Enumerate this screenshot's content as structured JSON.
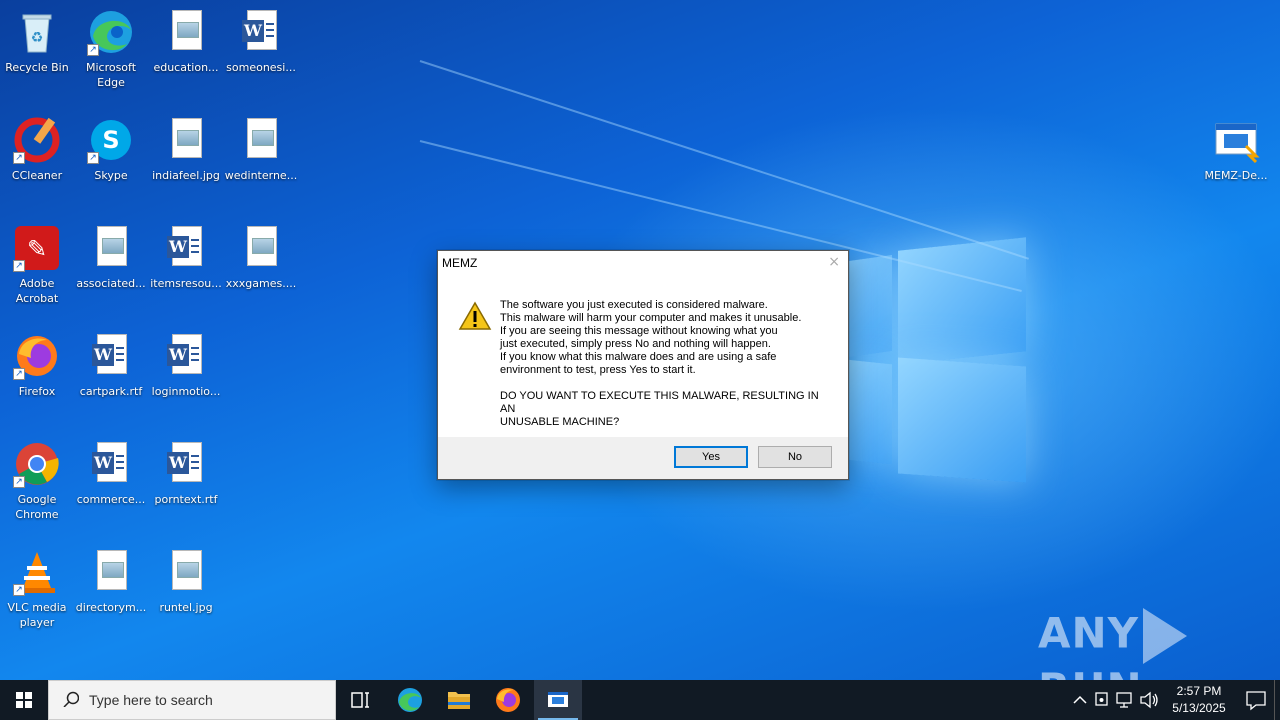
{
  "desktop": {
    "icons": [
      {
        "label": "Recycle Bin"
      },
      {
        "label": "Microsoft Edge"
      },
      {
        "label": "education..."
      },
      {
        "label": "someonesi..."
      },
      {
        "label": "CCleaner"
      },
      {
        "label": "Skype"
      },
      {
        "label": "indiafeel.jpg"
      },
      {
        "label": "wedinterne..."
      },
      {
        "label": "Adobe Acrobat"
      },
      {
        "label": "associated..."
      },
      {
        "label": "itemsresou..."
      },
      {
        "label": "xxxgames...."
      },
      {
        "label": "Firefox"
      },
      {
        "label": "cartpark.rtf"
      },
      {
        "label": "loginmotio..."
      },
      {
        "label": "Google Chrome"
      },
      {
        "label": "commerce..."
      },
      {
        "label": "porntext.rtf"
      },
      {
        "label": "VLC media player"
      },
      {
        "label": "directorym..."
      },
      {
        "label": "runtel.jpg"
      },
      {
        "label": "MEMZ-De..."
      }
    ]
  },
  "dialog": {
    "title": "MEMZ",
    "close": "×",
    "lines": [
      "The software you just executed is considered malware.",
      "This malware will harm your computer and makes it unusable.",
      "If you are seeing this message without knowing what you",
      "just executed, simply press No and nothing will happen.",
      "If you know what this malware does and are using a safe",
      "environment to test, press Yes to start it."
    ],
    "question": [
      "DO YOU WANT TO EXECUTE THIS MALWARE, RESULTING IN AN",
      "UNUSABLE MACHINE?"
    ],
    "yes": "Yes",
    "no": "No"
  },
  "watermark": {
    "left": "ANY",
    "right": "RUN"
  },
  "taskbar": {
    "search_placeholder": "Type here to search",
    "time": "2:57 PM",
    "date": "5/13/2025"
  }
}
